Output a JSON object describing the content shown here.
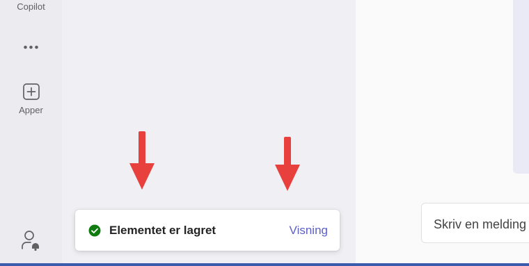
{
  "rail": {
    "copilot_label": "Copilot",
    "more_icon": "ellipsis-icon",
    "apps_label": "Apper",
    "apps_icon": "plus-square-icon",
    "bottom_icon": "person-bell-icon"
  },
  "toast": {
    "message": "Elementet er lagret",
    "action": "Visning",
    "status_icon": "checkmark-circle-icon",
    "status_color": "#107c10"
  },
  "compose": {
    "placeholder": "Skriv en melding"
  },
  "annotations": {
    "arrow_color": "#e8403c",
    "arrow_icon": "down-arrow-icon"
  },
  "colors": {
    "accent": "#5b5fc7",
    "taskbar": "#3b5bad"
  }
}
